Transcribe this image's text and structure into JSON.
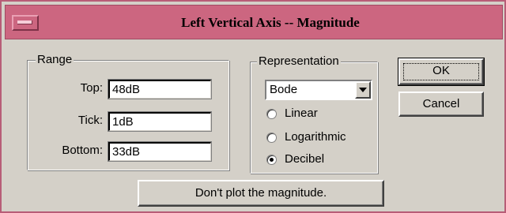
{
  "window": {
    "title": "Left Vertical Axis -- Magnitude"
  },
  "range": {
    "legend": "Range",
    "top": {
      "label": "Top:",
      "value": "48dB"
    },
    "tick": {
      "label": "Tick:",
      "value": "1dB"
    },
    "bottom": {
      "label": "Bottom:",
      "value": "33dB"
    }
  },
  "representation": {
    "legend": "Representation",
    "selected": "Bode",
    "options": [
      {
        "label": "Linear",
        "checked": false
      },
      {
        "label": "Logarithmic",
        "checked": false
      },
      {
        "label": "Decibel",
        "checked": true
      }
    ]
  },
  "buttons": {
    "ok": "OK",
    "cancel": "Cancel",
    "no_plot": "Don't plot the magnitude."
  },
  "colors": {
    "titlebar": "#cc6680",
    "dialog_bg": "#d4d0c8"
  }
}
